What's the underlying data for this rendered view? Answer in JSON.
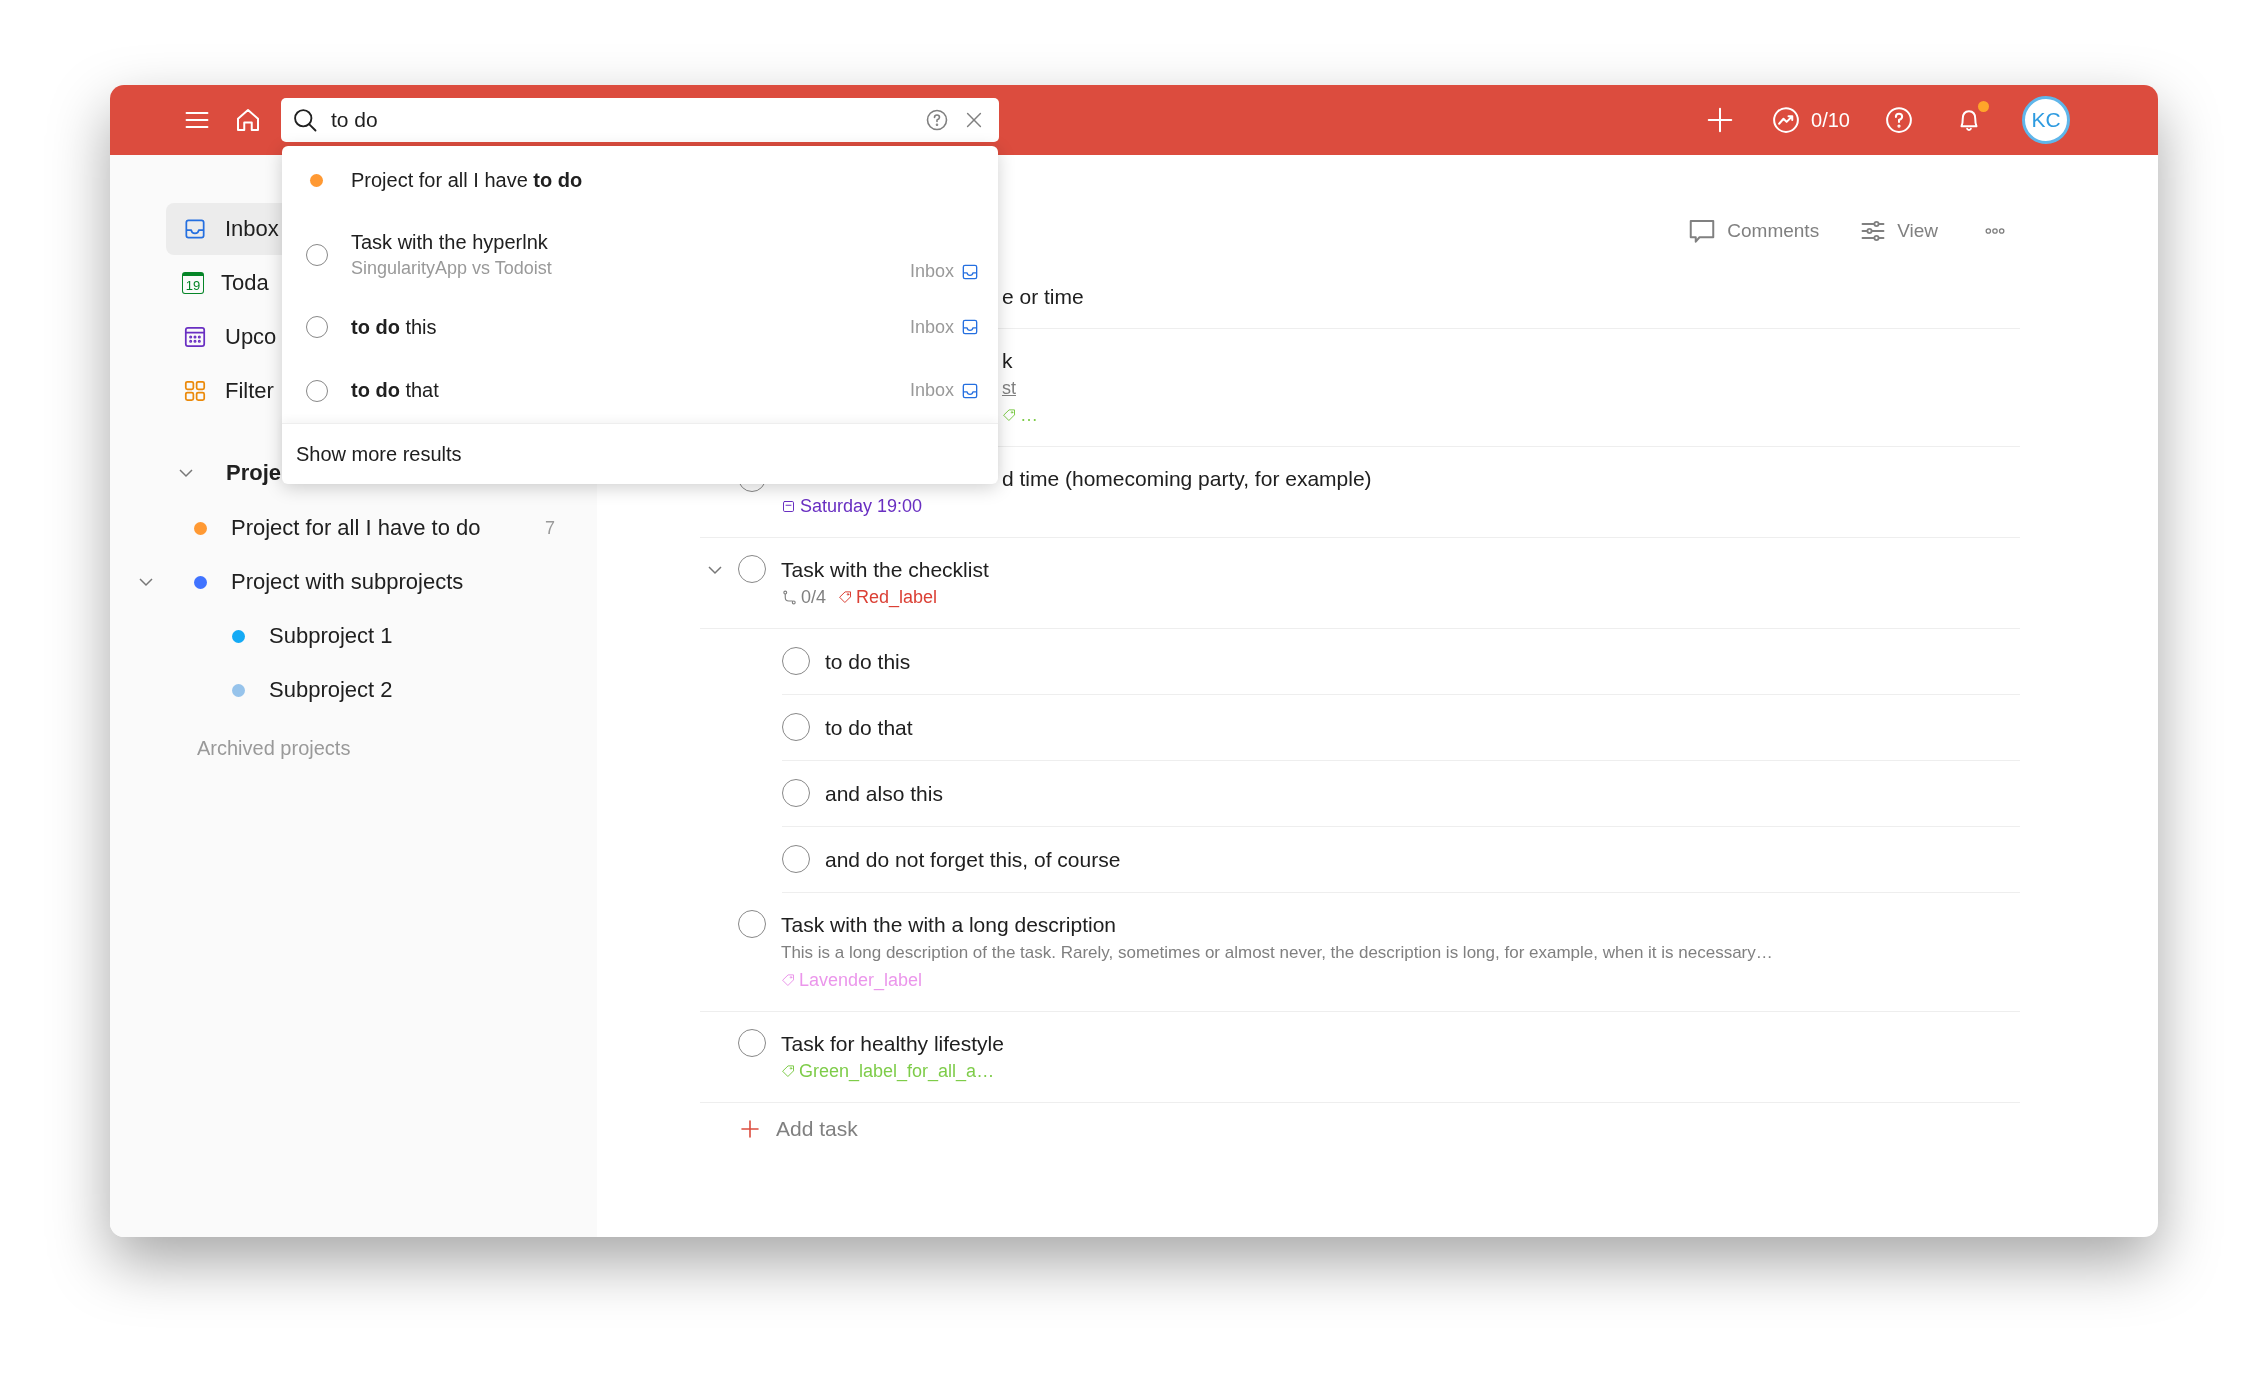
{
  "header": {
    "search": {
      "value": "to do"
    },
    "goal": "0/10",
    "notifications": {
      "unread": true
    },
    "avatar": "KC"
  },
  "search_results": [
    {
      "kind": "project",
      "title": "Project for all I have **to do**",
      "color": "#ff9933"
    },
    {
      "kind": "task",
      "checked": false,
      "title": "Task with the hyperlnk",
      "subtitle": "SingularityApp vs Todoist",
      "project": "Inbox"
    },
    {
      "kind": "task",
      "checked": false,
      "title": "**to do** this",
      "project": "Inbox"
    },
    {
      "kind": "task",
      "checked": false,
      "title": "**to do** that",
      "project": "Inbox"
    }
  ],
  "show_more": "Show more results",
  "sidebar": {
    "items": [
      {
        "kind": "inbox",
        "label": "Inbox",
        "selected": true
      },
      {
        "kind": "today",
        "label": "Toda",
        "icon_text": "19",
        "selected": false
      },
      {
        "kind": "upcoming",
        "label": "Upco",
        "selected": false
      },
      {
        "kind": "filters",
        "label": "Filter",
        "selected": false
      }
    ],
    "projects_heading": "Proje",
    "projects_expanded": true,
    "projects": [
      {
        "name": "Project for all I have to do",
        "color": "#ff9933",
        "count": "7"
      },
      {
        "name": "Project with subprojects",
        "color": "#4073ff",
        "expanded": true,
        "children": [
          {
            "name": "Subproject 1",
            "color": "#14aaf5"
          },
          {
            "name": "Subproject 2",
            "color": "#96c3eb"
          }
        ]
      }
    ],
    "archived": "Archived projects"
  },
  "toolbar": {
    "comments": "Comments",
    "view": "View"
  },
  "tasks": [
    {
      "kind": "covered",
      "title": "e or time"
    },
    {
      "kind": "covered",
      "title": "k",
      "link": "st",
      "labels": [
        {
          "text": "…",
          "color": "#7ecc49"
        }
      ]
    },
    {
      "kind": "partly_covered",
      "checked": false,
      "title": "d time (homecoming party, for example)",
      "due": "Saturday 19:00"
    },
    {
      "kind": "task",
      "checked": false,
      "title": "Task with the checklist",
      "expanded": true,
      "progress": "0/4",
      "labels": [
        {
          "text": "Red_label",
          "color": "#db4035"
        }
      ],
      "children": [
        {
          "checked": false,
          "title": "to do this"
        },
        {
          "checked": false,
          "title": "to do that"
        },
        {
          "checked": false,
          "title": "and also this"
        },
        {
          "checked": false,
          "title": "and do not forget this, of course"
        }
      ]
    },
    {
      "kind": "task",
      "checked": false,
      "title": "Task with the with a long description",
      "description": "This is a long description of the task. Rarely, sometimes or almost never, the description is long, for example, when it is necessary…",
      "labels": [
        {
          "text": "Lavender_label",
          "color": "#eb96eb"
        }
      ]
    },
    {
      "kind": "task",
      "checked": false,
      "title": "Task for healthy lifestyle",
      "labels": [
        {
          "text": "Green_label_for_all_a…",
          "color": "#7ecc49"
        }
      ]
    }
  ],
  "add_task": "Add task"
}
